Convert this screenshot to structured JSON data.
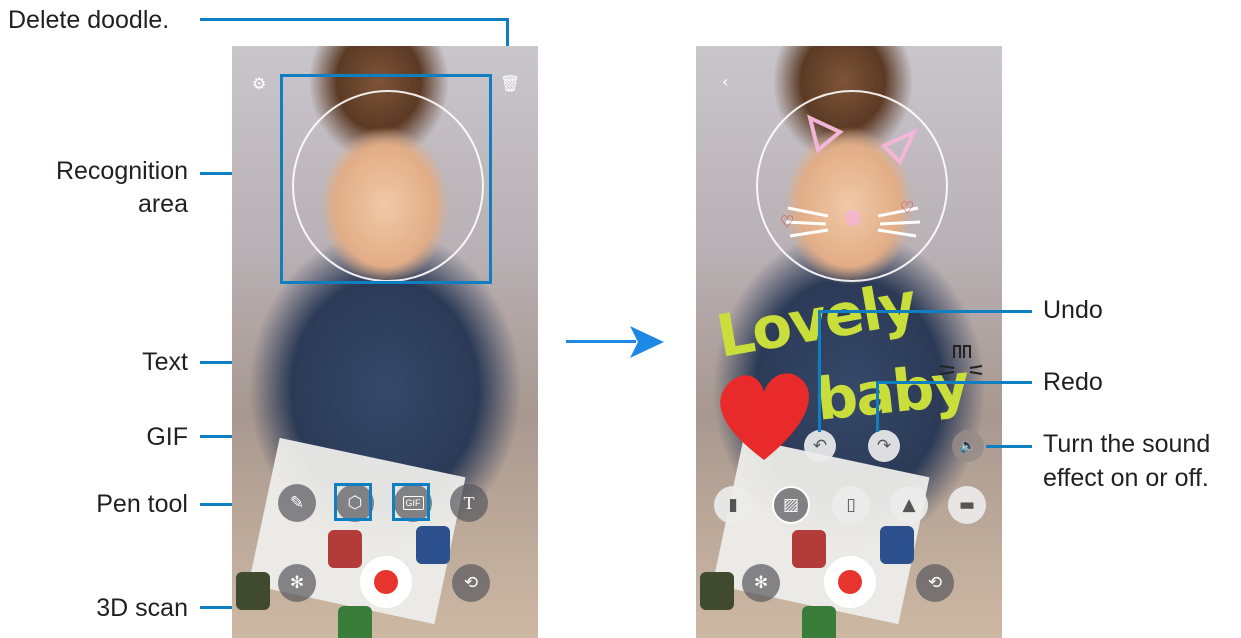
{
  "callouts": {
    "delete_doodle": "Delete doodle.",
    "recognition_area_line1": "Recognition",
    "recognition_area_line2": "area",
    "text": "Text",
    "gif": "GIF",
    "pen_tool": "Pen tool",
    "scan_3d": "3D scan",
    "undo": "Undo",
    "redo": "Redo",
    "sound_line1": "Turn the sound",
    "sound_line2": "effect on or off."
  },
  "left_screen": {
    "icons": [
      "settings-icon",
      "trash-icon",
      "pen-icon",
      "3d-scan-icon",
      "gif-icon",
      "text-icon",
      "effects-icon",
      "record-button",
      "switch-camera-icon"
    ],
    "gif_badge": "GIF",
    "text_glyph": "T"
  },
  "right_screen": {
    "doodle_word1": "Lovely",
    "doodle_word2": "baby",
    "icons": [
      "back-icon",
      "undo-icon",
      "redo-icon",
      "sound-icon",
      "pen-style-icon",
      "effects-icon",
      "record-button",
      "switch-camera-icon"
    ]
  },
  "colors": {
    "callout_line": "#0f7fc1",
    "arrow": "#1e88e5",
    "record": "#e8342f",
    "doodle_green": "#c9de3a",
    "doodle_heart": "#e82a2a"
  }
}
